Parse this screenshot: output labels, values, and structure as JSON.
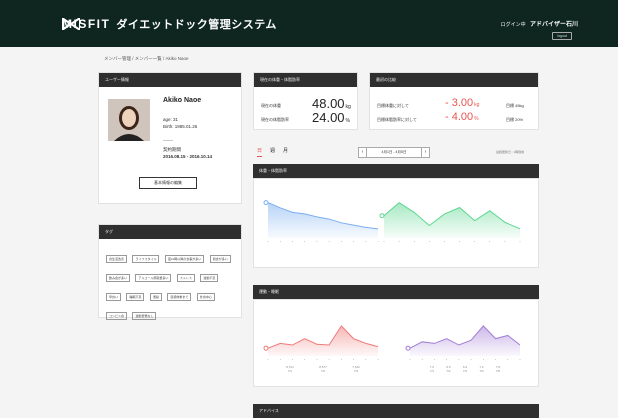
{
  "header": {
    "brand": "MISFIT",
    "subtitle": "ダイエットドック管理システム",
    "login_text": "ログイン中",
    "login_user": "アドバイザー石川",
    "logout_label": "logout"
  },
  "breadcrumb": "メンバー管理 / メンバー一覧 / Akiko Naoe",
  "user_panel": {
    "title": "ユーザー情報",
    "name": "Akiko Naoe",
    "age": "age: 31",
    "birth": "Birth: 1985.01.26",
    "contract_label": "契約期間",
    "contract_range": "2016.08.15 - 2016.10.14",
    "edit_button": "基本情報の編集"
  },
  "tags_panel": {
    "title": "タグ",
    "tags": [
      "食生活改善",
      "ライフスタイル",
      "夜10時以降の食事が多い",
      "間食が多い",
      "飲み会が多い",
      "アルコール摂取量多い",
      "ストレス",
      "運動不足",
      "早食い",
      "睡眠不足",
      "便秘",
      "目標体重まで",
      "外食中心",
      "コンビニ食",
      "運動習慣なし"
    ]
  },
  "current_panel": {
    "title": "現在の体重・体脂肪率",
    "weight_label": "現在の体重",
    "weight_value": "48.00",
    "weight_unit": "kg",
    "fat_label": "現在の体脂肪率",
    "fat_value": "24.00",
    "fat_unit": "%"
  },
  "goal_panel": {
    "title": "最初の比較",
    "weight_label": "目標体重に対して",
    "weight_change": "- 3.00",
    "weight_unit": "kg",
    "weight_target": "目標 45kg",
    "fat_label": "目標体脂肪率に対して",
    "fat_change": "- 4.00",
    "fat_unit": "%",
    "fat_target": "目標 20%"
  },
  "period_tabs": [
    "日",
    "週",
    "月"
  ],
  "date_nav": {
    "prev": "‹",
    "range": "4月1日 - 4月5日",
    "next": "›"
  },
  "update_info": "最終更新日 : 1時間前",
  "sections": {
    "body_title": "体重・体脂肪率",
    "activity_title": "運動・睡眠",
    "advice_title": "アドバイス"
  },
  "chart_data": [
    {
      "type": "area",
      "x": [
        "1",
        "2",
        "3",
        "4",
        "5",
        "6",
        "7",
        "8",
        "9",
        "10"
      ],
      "values": [
        51.5,
        50.8,
        50.2,
        50.0,
        49.6,
        49.3,
        48.8,
        48.5,
        48.2,
        48.0
      ],
      "color": "#7aaef0"
    },
    {
      "type": "area",
      "x": [
        "1",
        "2",
        "3",
        "4",
        "5",
        "6",
        "7",
        "8",
        "9",
        "10"
      ],
      "values": [
        24.8,
        25.6,
        25.0,
        24.2,
        24.9,
        25.3,
        24.5,
        25.1,
        24.4,
        24.0
      ],
      "color": "#5fd691"
    },
    {
      "type": "area",
      "x": [
        "1",
        "2",
        "3",
        "4",
        "5",
        "6",
        "7",
        "8",
        "9",
        "10"
      ],
      "values": [
        2000,
        2600,
        2400,
        3200,
        2500,
        2400,
        4800,
        3200,
        2600,
        2200
      ],
      "color": "#f07a7a",
      "labels": [
        "8,721",
        "8,577",
        "7,512"
      ],
      "sublabels": [
        "7/1",
        "7/2",
        "7/3"
      ]
    },
    {
      "type": "area",
      "x": [
        "1",
        "2",
        "3",
        "4",
        "5",
        "6",
        "7",
        "8",
        "9",
        "10"
      ],
      "values": [
        5.8,
        6.2,
        6.1,
        6.4,
        6.0,
        6.3,
        7.2,
        6.4,
        6.6,
        6.0
      ],
      "color": "#a37cd6",
      "labels": [
        "7.5",
        "6.5",
        "6.9",
        "7.2",
        "7.8"
      ],
      "sublabels": [
        "7/1",
        "7/2",
        "7/3",
        "7/4",
        "7/5"
      ]
    }
  ]
}
